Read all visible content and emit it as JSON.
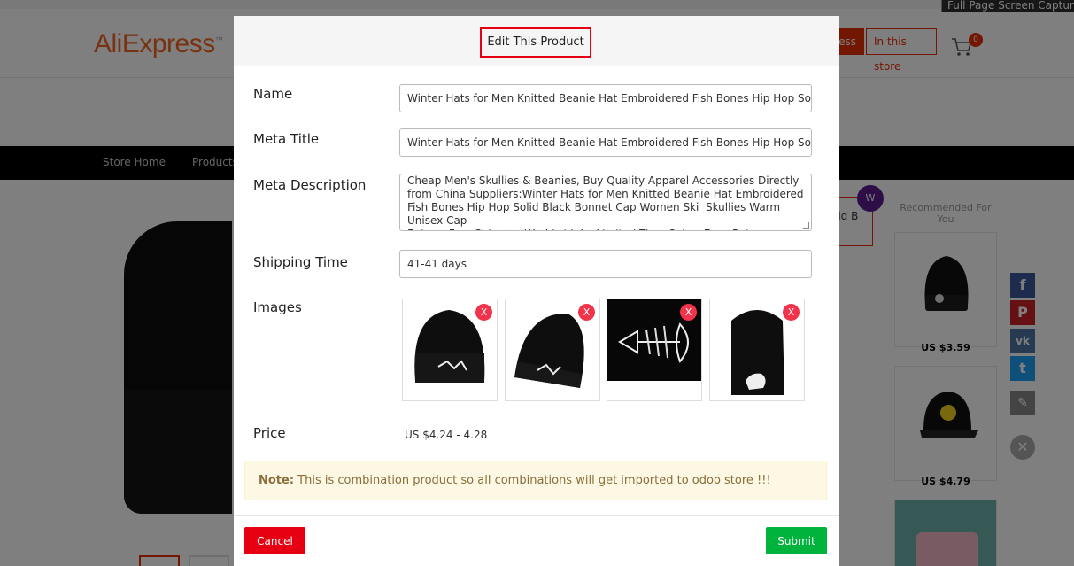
{
  "tooltip": "Full Page Screen Capture",
  "header": {
    "logo": "AliExpress",
    "search_all_label": "ess",
    "search_store_label": "In this store",
    "cart_count": "0"
  },
  "store_nav": {
    "items": [
      "Store Home",
      "Products"
    ]
  },
  "product_title_fragment": "lid B",
  "recommended": {
    "title": "Recommended For You",
    "prices": [
      "US $3.59",
      "US $4.79"
    ]
  },
  "modal": {
    "title": "Edit This Product",
    "fields": {
      "name_label": "Name",
      "name_value": "Winter Hats for Men Knitted Beanie Hat Embroidered Fish Bones Hip Hop Solid Black Bonnet Cap Women Ski Skullies Warm Unisex Cap",
      "meta_title_label": "Meta Title",
      "meta_title_value": "Winter Hats for Men Knitted Beanie Hat Embroidered Fish Bones Hip Hop Solid Black Bonnet Cap Women Ski Skullies Warm Unisex Cap",
      "meta_description_label": "Meta Description",
      "meta_description_value": "Cheap Men's Skullies & Beanies, Buy Quality Apparel Accessories Directly from China Suppliers:Winter Hats for Men Knitted Beanie Hat Embroidered Fish Bones Hip Hop Solid Black Bonnet Cap Women Ski  Skullies Warm Unisex Cap\nEnjoy ✓Free Shipping Worldwide! ✓Limited Time Sale ✓Easy Return.",
      "shipping_time_label": "Shipping Time",
      "shipping_time_value": "41-41 days",
      "images_label": "Images",
      "remove_label": "X",
      "price_label": "Price",
      "price_value": "US $4.24 - 4.28"
    },
    "note_label": "Note:",
    "note_text": " This is combination product so all combinations will get imported to odoo store !!!",
    "cancel_label": "Cancel",
    "submit_label": "Submit"
  },
  "colors": {
    "brand": "#f26522",
    "danger": "#e60012",
    "success": "#00b33c",
    "note_bg": "#fcf8e3",
    "note_text": "#8a6d3b"
  }
}
